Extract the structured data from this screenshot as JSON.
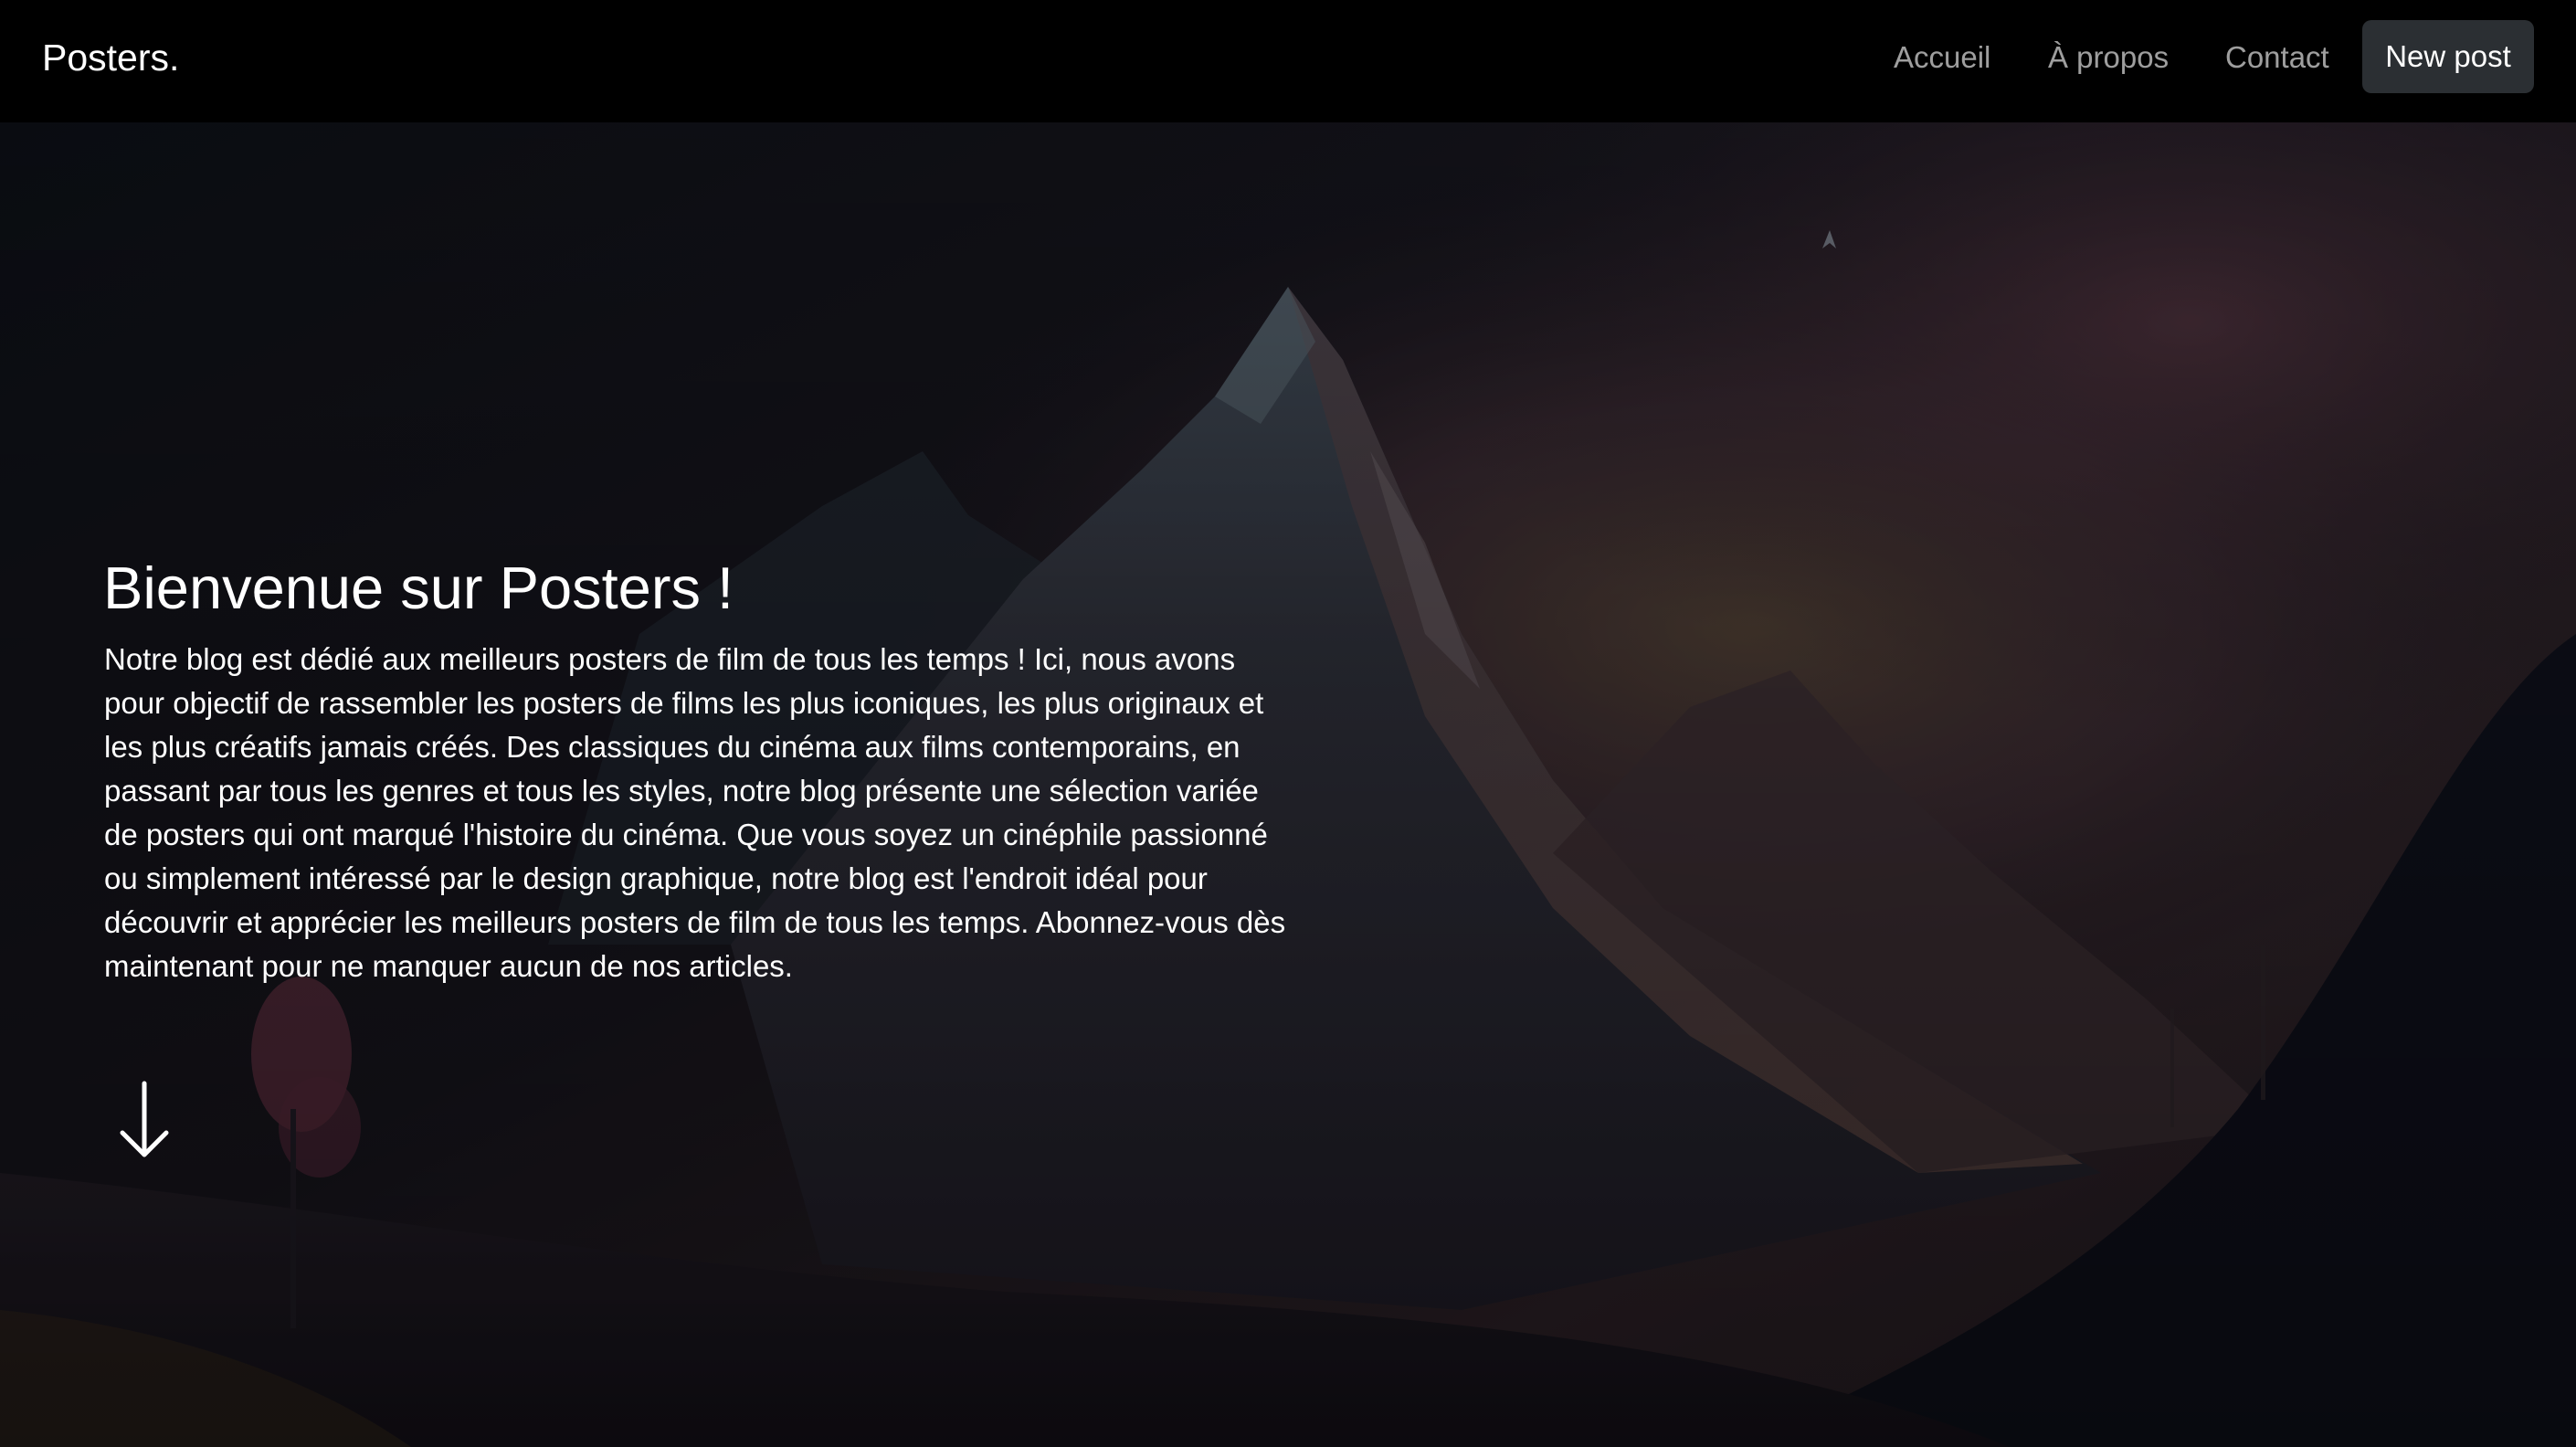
{
  "navbar": {
    "brand": "Posters.",
    "links": [
      {
        "label": "Accueil"
      },
      {
        "label": "À propos"
      },
      {
        "label": "Contact"
      }
    ],
    "new_post_label": "New post"
  },
  "hero": {
    "title": "Bienvenue sur Posters !",
    "text": "Notre blog est dédié aux meilleurs posters de film de tous les temps ! Ici, nous avons pour objectif de rassembler les posters de films les plus iconiques, les plus originaux et les plus créatifs jamais créés. Des classiques du cinéma aux films contemporains, en passant par tous les genres et tous les styles, notre blog présente une sélection variée de posters qui ont marqué l'histoire du cinéma. Que vous soyez un cinéphile passionné ou simplement intéressé par le design graphique, notre blog est l'endroit idéal pour découvrir et apprécier les meilleurs posters de film de tous les temps. Abonnez-vous dès maintenant pour ne manquer aucun de nos articles.",
    "scroll_icon": "arrow-down-icon"
  },
  "colors": {
    "navbar_bg": "#000000",
    "button_bg": "#2b2f33",
    "link_muted": "rgba(255,255,255,0.62)"
  }
}
